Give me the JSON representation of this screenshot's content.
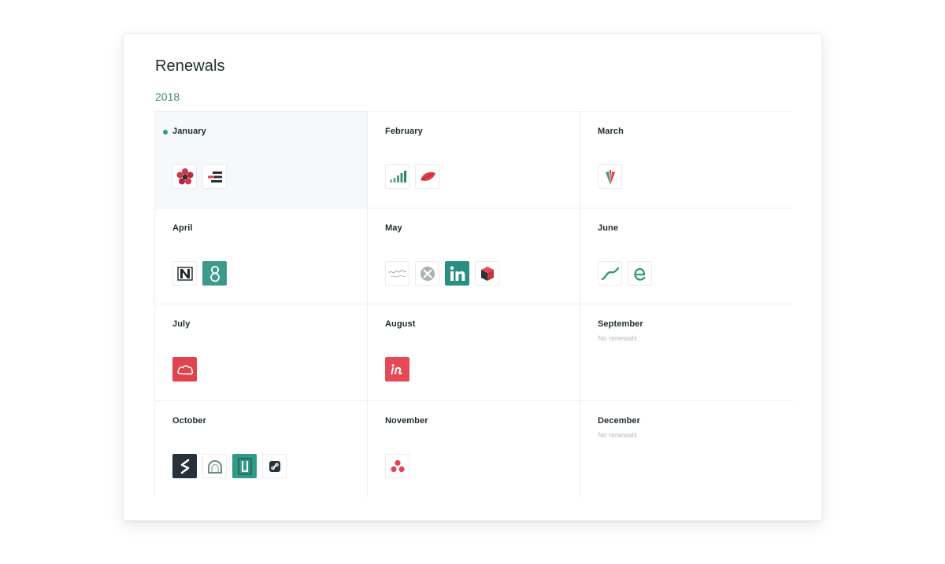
{
  "page": {
    "title": "Renewals",
    "year": "2018"
  },
  "months": [
    {
      "name": "January",
      "current": true,
      "empty_text": "",
      "logos": [
        "flower-logo-icon",
        "stripes-logo-icon"
      ]
    },
    {
      "name": "February",
      "current": false,
      "empty_text": "",
      "logos": [
        "signal-bars-logo-icon",
        "red-leaf-logo-icon"
      ]
    },
    {
      "name": "March",
      "current": false,
      "empty_text": "",
      "logos": [
        "tulip-logo-icon"
      ]
    },
    {
      "name": "April",
      "current": false,
      "empty_text": "",
      "logos": [
        "n-letter-logo-icon",
        "eight-logo-icon"
      ]
    },
    {
      "name": "May",
      "current": false,
      "empty_text": "",
      "logos": [
        "script-logo-icon",
        "circle-x-logo-icon",
        "linkedin-logo-icon",
        "cube-logo-icon"
      ]
    },
    {
      "name": "June",
      "current": false,
      "empty_text": "",
      "logos": [
        "swoosh-logo-icon",
        "e-letter-logo-icon"
      ]
    },
    {
      "name": "July",
      "current": false,
      "empty_text": "",
      "logos": [
        "red-cloud-logo-icon"
      ]
    },
    {
      "name": "August",
      "current": false,
      "empty_text": "",
      "logos": [
        "invision-logo-icon"
      ]
    },
    {
      "name": "September",
      "current": false,
      "empty_text": "No renewals",
      "logos": []
    },
    {
      "name": "October",
      "current": false,
      "empty_text": "",
      "logos": [
        "s-letter-logo-icon",
        "arch-logo-icon",
        "bracket-logo-icon",
        "link-logo-icon"
      ]
    },
    {
      "name": "November",
      "current": false,
      "empty_text": "",
      "logos": [
        "three-dots-logo-icon"
      ]
    },
    {
      "name": "December",
      "current": false,
      "empty_text": "No renewals",
      "logos": []
    }
  ],
  "colors": {
    "accent": "#2f9a80",
    "year": "#3d8a7a",
    "current_bg": "#f5f9fc",
    "border": "#edf0f1"
  }
}
